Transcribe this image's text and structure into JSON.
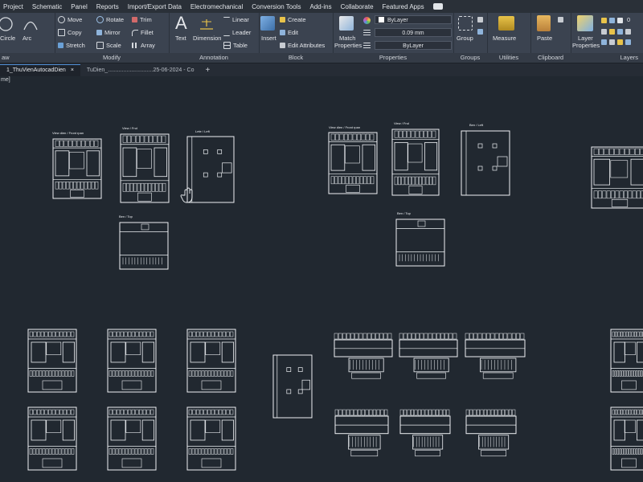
{
  "menu": {
    "items": [
      "Project",
      "Schematic",
      "Panel",
      "Reports",
      "Import/Export Data",
      "Electromechanical",
      "Conversion Tools",
      "Add-ins",
      "Collaborate",
      "Featured Apps"
    ]
  },
  "ribbon": {
    "draw": {
      "title": "aw",
      "circle": "Circle",
      "arc": "Arc"
    },
    "modify": {
      "title": "Modify",
      "move": "Move",
      "rotate": "Rotate",
      "trim": "Trim",
      "copy": "Copy",
      "mirror": "Mirror",
      "fillet": "Fillet",
      "stretch": "Stretch",
      "scale": "Scale",
      "array": "Array"
    },
    "annotation": {
      "title": "Annotation",
      "text": "Text",
      "dimension": "Dimension",
      "linear": "Linear",
      "leader": "Leader",
      "table": "Table"
    },
    "block": {
      "title": "Block",
      "insert": "Insert",
      "create": "Create",
      "edit": "Edit",
      "edit_attributes": "Edit Attributes"
    },
    "properties": {
      "title": "Properties",
      "match": "Match",
      "match2": "Properties",
      "color": "ByLayer",
      "lineweight": "0.09 mm",
      "linetype": "ByLayer"
    },
    "groups": {
      "title": "Groups",
      "group": "Group"
    },
    "utilities": {
      "title": "Utilities",
      "measure": "Measure"
    },
    "clipboard": {
      "title": "Clipboard",
      "paste": "Paste"
    },
    "layers": {
      "title": "Layers",
      "layer": "Layer",
      "layer2": "Properties",
      "value": "0"
    }
  },
  "tabs": {
    "tab1": "1_ThuVienAutocadDien",
    "tab2": "TuDien_.............................25-06-2024 - Co",
    "close": "×",
    "add": "+"
  },
  "canvas": {
    "cmd": "me]",
    "labels": {
      "front1": "View dien / Front rpan",
      "side1": "View / Fnd",
      "left1": "Lete / Left",
      "top1": "Ben / Top",
      "front2": "View dien / Front rpan",
      "side2": "View / Fnd",
      "left2": "Ben / Left",
      "top2": "Ben / Top"
    }
  },
  "colors": {
    "accent": "#4f8fd6",
    "canvas": "#212830",
    "ribbon": "#3b4350",
    "line": "#f2f4f6"
  }
}
